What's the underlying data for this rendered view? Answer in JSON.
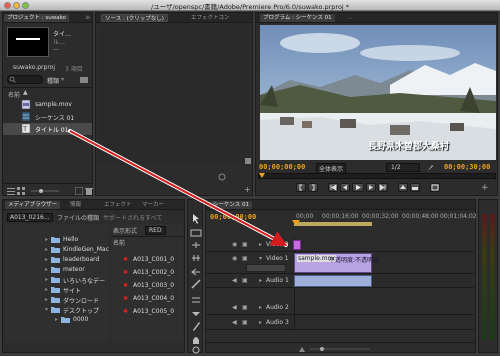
{
  "window": {
    "title": "/ユーザ/openspc/書籍/Adobe/Premiere Pro/6.0/suwako.prproj *"
  },
  "project": {
    "tab_label": "プロジェクト : suwako",
    "menu_glyph": "≡",
    "tab2_label": "メディアブラウザー",
    "preview_name": "タイ…",
    "preview_line2": "ル…",
    "project_file": "suwako.prproj",
    "item_count": "3 項目",
    "search_mode": "種類",
    "col_header": "名前",
    "items": [
      {
        "name": "sample.mov"
      },
      {
        "name": "シーケンス 01"
      },
      {
        "name": "タイトル 01"
      }
    ]
  },
  "source": {
    "tab1": "ソース : (クリップなし)",
    "tab2": "エフェクトコン",
    "tab3": "オーディオ"
  },
  "program": {
    "tab_label": "プログラム : シーケンス 01",
    "tab_ellipsis": "…",
    "overlay_text": "長野県木曽郡大桑村",
    "timecode_left": "00;00;00;00",
    "timecode_right": "00;00;30;00",
    "fit_select": "全体表示",
    "zoom_select": "1/2"
  },
  "media": {
    "tab_active": "メディアブラウザー",
    "tab2": "情報",
    "tab3": "エフェクト",
    "tab4": "マーカー",
    "tab5": "ヒストリ",
    "drive_select": "A013_0216...",
    "file_type_label": "ファイルの種類",
    "file_type_value": "サポートされるすべて",
    "display_label": "表示形式",
    "display_value": "RED",
    "col_name": "名前",
    "folders": [
      "Hello",
      "KindleGen_Mac",
      "leaderboard",
      "meteor",
      "いろいろなデー",
      "サイト",
      "ダウンロード",
      "デスクトップ",
      "0000"
    ],
    "files": [
      "A013_C001_0",
      "A013_C002_0",
      "A013_C003_0",
      "A013_C004_0",
      "A013_C005_0"
    ]
  },
  "timeline": {
    "tab_label": "シーケンス 01",
    "timecode": "00;00;00;00",
    "ruler": [
      "00;00",
      "00;00;16;00",
      "00;00;32;00",
      "00;00;48;00",
      "00;01;04;02"
    ],
    "tracks": [
      {
        "name": "Video 2"
      },
      {
        "name": "Video 1"
      },
      {
        "name": "Audio 1"
      },
      {
        "name": "Audio 2"
      },
      {
        "name": "Audio 3"
      }
    ],
    "clip_video1": "sample.mov",
    "clip_video1_fx": "不透明度:不透明度",
    "clip_video1_fx2": "[V]",
    "clip_audio1": "sample.mov"
  },
  "colors": {
    "accent_timecode": "#e9a21a",
    "clip_video": "#b9a3e3",
    "clip_audio": "#9db0dc",
    "arrow": "#d41c1c",
    "dropping_clip": "#c96be0"
  }
}
